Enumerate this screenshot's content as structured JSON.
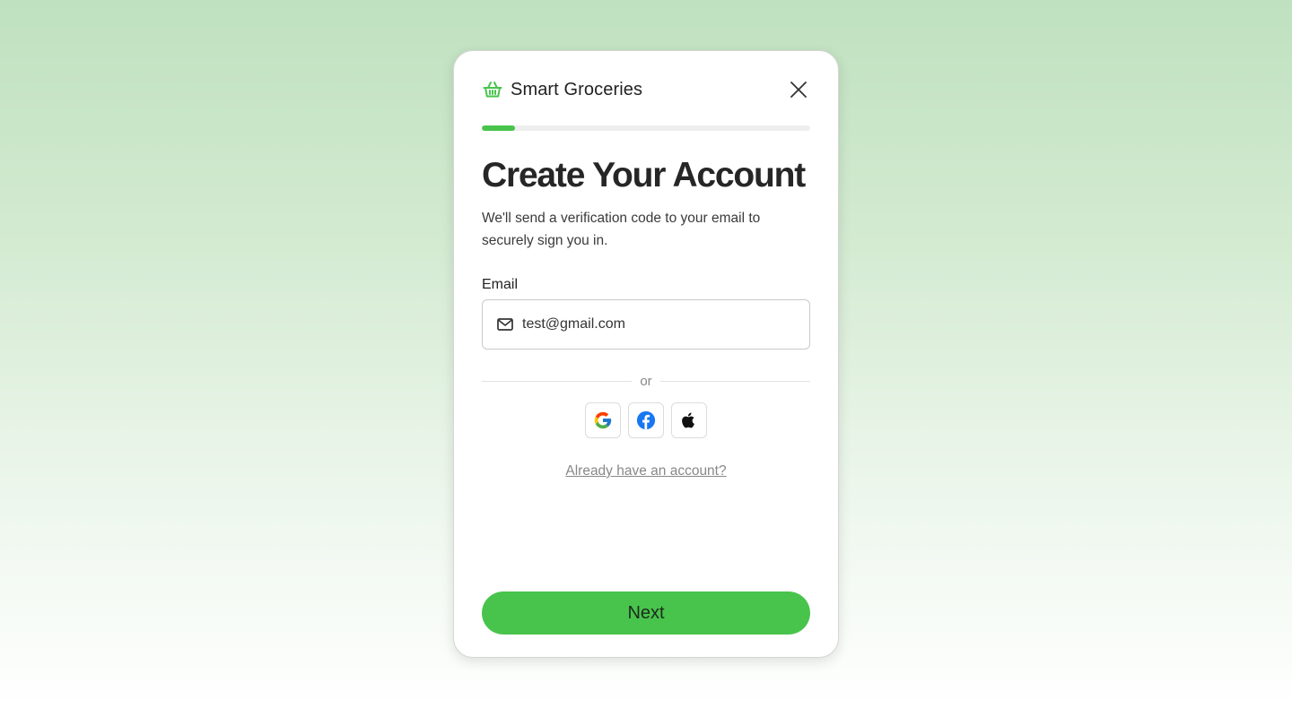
{
  "app": {
    "brand_name": "Smart Groceries",
    "brand_icon": "basket-icon",
    "accent_color": "#48c44c"
  },
  "progress": {
    "value": 0.1
  },
  "form": {
    "title": "Create Your Account",
    "subtitle": "We'll send a verification code to your email to securely sign you in.",
    "email_label": "Email",
    "email_value": "test@gmail.com",
    "divider_text": "or",
    "social_buttons": [
      {
        "name": "google-icon",
        "provider": "Google"
      },
      {
        "name": "facebook-icon",
        "provider": "Facebook"
      },
      {
        "name": "apple-icon",
        "provider": "Apple"
      }
    ],
    "signin_link": "Already have an account?",
    "next_label": "Next"
  }
}
